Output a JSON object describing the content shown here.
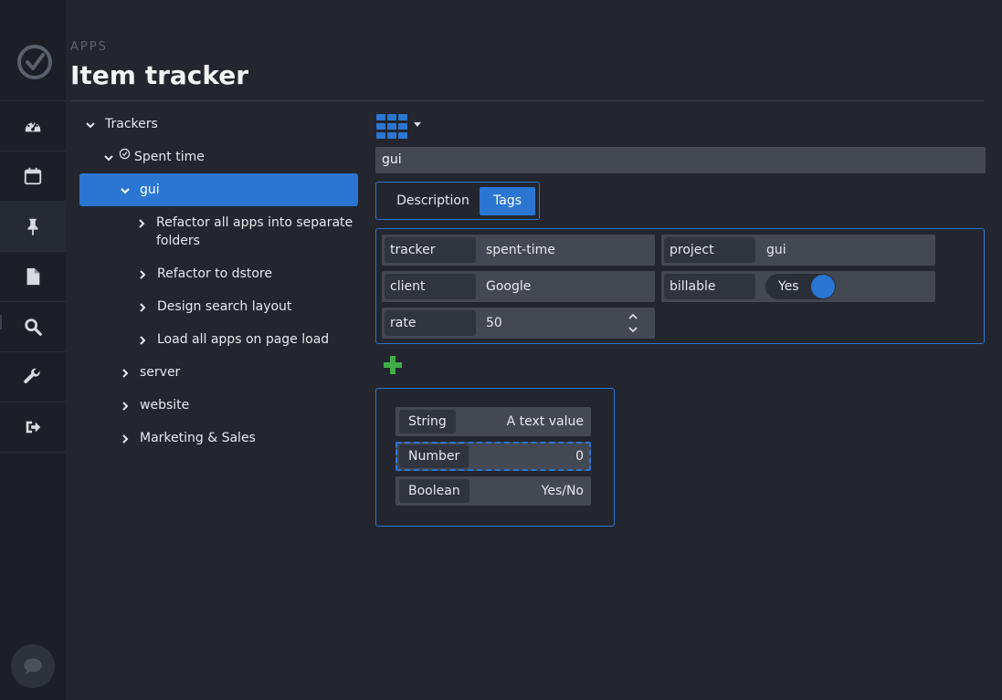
{
  "header": {
    "section": "APPS",
    "title": "Item tracker"
  },
  "rail": {
    "items": [
      {
        "icon": "dashboard-icon"
      },
      {
        "icon": "calendar-icon"
      },
      {
        "icon": "pin-icon"
      },
      {
        "icon": "document-icon"
      },
      {
        "icon": "search-icon"
      },
      {
        "icon": "wrench-icon"
      },
      {
        "icon": "sign-out-icon"
      }
    ],
    "chat_icon": "chat-icon"
  },
  "tree": {
    "root": "Trackers",
    "tracker": "Spent time",
    "selected": "gui",
    "children": [
      "Refactor all apps into separate",
      "folders",
      "Refactor to dstore",
      "Design search layout",
      "Load all apps on page load"
    ],
    "siblings": [
      "server",
      "website",
      "Marketing & Sales"
    ]
  },
  "detail": {
    "title_value": "gui",
    "tabs": [
      "Description",
      "Tags"
    ],
    "active_tab": "Tags",
    "tags": {
      "tracker": {
        "key": "tracker",
        "value": "spent-time"
      },
      "project": {
        "key": "project",
        "value": "gui"
      },
      "client": {
        "key": "client",
        "value": "Google"
      },
      "billable": {
        "key": "billable",
        "value": "Yes"
      },
      "rate": {
        "key": "rate",
        "value": "50"
      }
    },
    "types": [
      {
        "key": "String",
        "value": "A text value"
      },
      {
        "key": "Number",
        "value": "0"
      },
      {
        "key": "Boolean",
        "value": "Yes/No"
      }
    ]
  },
  "colors": {
    "accent": "#2a76d2",
    "background": "#23262e",
    "rail": "#1c1f26",
    "add": "#3fae49"
  }
}
